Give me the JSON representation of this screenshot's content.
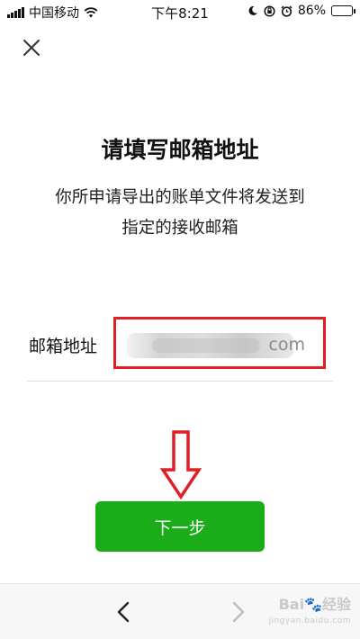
{
  "status_bar": {
    "carrier": "中国移动",
    "time": "下午8:21",
    "battery": "86%",
    "battery_level": 0.86,
    "icons": [
      "signal-icon",
      "wifi-icon",
      "moon-icon",
      "orientation-lock-icon",
      "alarm-icon",
      "battery-icon"
    ]
  },
  "page": {
    "title": "请填写邮箱地址",
    "description_line1": "你所申请导出的账单文件将发送到",
    "description_line2": "指定的接收邮箱"
  },
  "email": {
    "label": "邮箱地址",
    "value_visible_suffix": "com"
  },
  "next_button": {
    "label": "下一步",
    "color": "#1aad19"
  },
  "annotation": {
    "highlight_color": "#e01e26"
  },
  "watermark": {
    "brand": "Bai",
    "brand_suffix": "经验",
    "site": "jingyan.baidu.com"
  }
}
